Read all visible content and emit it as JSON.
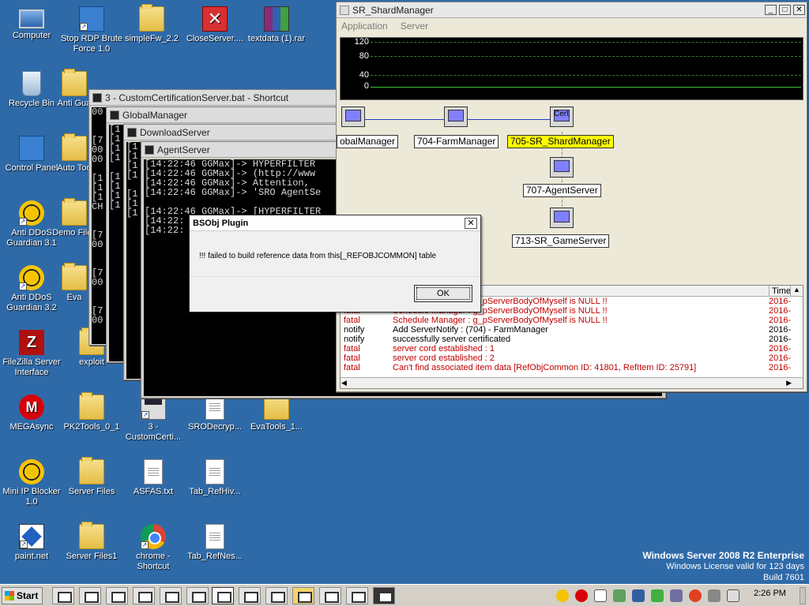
{
  "desktop": {
    "icons": [
      {
        "label": "Computer"
      },
      {
        "label": "Stop RDP Brute Force 1.0"
      },
      {
        "label": "simpleFw_2.2"
      },
      {
        "label": "CloseServer...."
      },
      {
        "label": "textdata (1).rar"
      },
      {
        "label": "Recycle Bin"
      },
      {
        "label": "Anti Gua"
      },
      {
        "label": "Control Panel"
      },
      {
        "label": "Auto Too"
      },
      {
        "label": "Anti DDoS Guardian 3.1"
      },
      {
        "label": "Demo Files"
      },
      {
        "label": "Anti DDoS Guardian 3.2"
      },
      {
        "label": "Eva"
      },
      {
        "label": "FileZilla Server Interface"
      },
      {
        "label": "exploit"
      },
      {
        "label": "MEGAsync"
      },
      {
        "label": "PK2Tools_0_1"
      },
      {
        "label": "3 - CustomCerti..."
      },
      {
        "label": "SRODecryp..."
      },
      {
        "label": "EvaTools_1..."
      },
      {
        "label": "Mini IP Blocker 1.0"
      },
      {
        "label": "Server Files"
      },
      {
        "label": "ASFAS.txt"
      },
      {
        "label": "Tab_RefHiv..."
      },
      {
        "label": "paint.net"
      },
      {
        "label": "Server Files1"
      },
      {
        "label": "chrome - Shortcut"
      },
      {
        "label": "Tab_RefNes..."
      }
    ]
  },
  "windows": {
    "cert_console": {
      "title": "3 - CustomCertificationServer.bat - Shortcut",
      "lines": [
        "00",
        "",
        "",
        "[7",
        "00",
        "00",
        "",
        "[1",
        "[1",
        "[1",
        "CH",
        "",
        "",
        "[7",
        "00",
        "",
        "",
        "[7",
        "00",
        "",
        "",
        "[7",
        "00",
        "",
        "",
        "[7",
        "00"
      ]
    },
    "global_manager": {
      "title": "GlobalManager",
      "lines": [
        "[1",
        "[1",
        "[1",
        "[1",
        "",
        "[1",
        "[1",
        "[1",
        "[1"
      ]
    },
    "download_server": {
      "title": "DownloadServer",
      "lines": [
        "[1",
        "[1",
        "[1",
        "[1",
        "",
        "[1",
        "[1",
        "[1"
      ]
    },
    "agent_server": {
      "title": "AgentServer",
      "lines": [
        "[14:22:46 GGMax]-> HYPERFILTER",
        "[14:22:46 GGMax]-> (http://www",
        "[14:22:46 GGMax]-> Attention, ",
        "[14:22:46 GGMax]-> 'SRO AgentSe",
        "",
        "[14:22:46 GGMax]-> [HYPERFILTER",
        "[14:22:",
        "[14:22:"
      ]
    }
  },
  "shard_manager": {
    "title": "SR_ShardManager",
    "menu": [
      "Application",
      "Server"
    ],
    "graph": {
      "y_labels": [
        "120",
        "80",
        "40",
        "0"
      ]
    },
    "nodes": [
      {
        "label": "GlobalManager",
        "display": "obalManager"
      },
      {
        "label": "704-FarmManager"
      },
      {
        "label": "705-SR_ShardManager",
        "icon_text": "Cert"
      },
      {
        "label": "707-AgentServer"
      },
      {
        "label": "713-SR_GameServer"
      }
    ],
    "log": {
      "time_header": "Time",
      "rows": [
        {
          "level": "fatal",
          "msg": "Schedule Manager : g_pServerBodyOfMyself is NULL !!",
          "time": "2016-",
          "color": "#c00000"
        },
        {
          "level": "fatal",
          "msg": "Schedule Manager : g_pServerBodyOfMyself is NULL !!",
          "time": "2016-",
          "color": "#c00000"
        },
        {
          "level": "fatal",
          "msg": "Schedule Manager : g_pServerBodyOfMyself is NULL !!",
          "time": "2016-",
          "color": "#c00000"
        },
        {
          "level": "notify",
          "msg": "Add ServerNotify : (704) - FarmManager",
          "time": "2016-",
          "color": "#000000"
        },
        {
          "level": "notify",
          "msg": "successfully server certificated",
          "time": "2016-",
          "color": "#000000"
        },
        {
          "level": "fatal",
          "msg": "server cord established : 1",
          "time": "2016-",
          "color": "#c00000"
        },
        {
          "level": "fatal",
          "msg": "server cord established : 2",
          "time": "2016-",
          "color": "#c00000"
        },
        {
          "level": "fatal",
          "msg": "Can't find associated item data [RefObjCommon ID: 41801, RefItem ID: 25791]",
          "time": "2016-",
          "color": "#c00000"
        }
      ]
    }
  },
  "dialog": {
    "title": "BSObj Plugin",
    "message": "!!! failed to build reference data from this[_REFOBJCOMMON] table",
    "ok_label": "OK",
    "close_glyph": "✕"
  },
  "taskbar": {
    "start_label": "Start",
    "clock": "2:26 PM"
  },
  "watermark": {
    "edition": "Windows Server 2008 R2 Enterprise",
    "license": "Windows License valid for 123 days",
    "build": "Build 7601"
  }
}
